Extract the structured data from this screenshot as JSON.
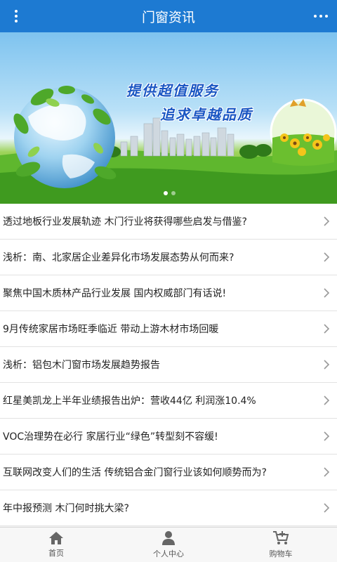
{
  "header": {
    "title": "门窗资讯"
  },
  "banner": {
    "slogan_line1": "提供超值服务",
    "slogan_line2": "追求卓越品质",
    "carousel": {
      "slide_count": 2,
      "active_index": 0
    }
  },
  "news": [
    {
      "title": "透过地板行业发展轨迹 木门行业将获得哪些启发与借鉴?"
    },
    {
      "title": "浅析：南、北家居企业差异化市场发展态势从何而来?"
    },
    {
      "title": "聚焦中国木质林产品行业发展 国内权威部门有话说!"
    },
    {
      "title": "9月传统家居市场旺季临近 带动上游木材市场回暖"
    },
    {
      "title": "浅析：铝包木门窗市场发展趋势报告"
    },
    {
      "title": "红星美凯龙上半年业绩报告出炉：营收44亿 利润涨10.4%"
    },
    {
      "title": "VOC治理势在必行 家居行业“绿色”转型刻不容缓!"
    },
    {
      "title": "互联网改变人们的生活 传统铝合金门窗行业该如何顺势而为?"
    },
    {
      "title": "年中报预测 木门何时挑大梁?"
    }
  ],
  "tabbar": {
    "home": "首页",
    "profile": "个人中心",
    "cart": "购物车"
  }
}
